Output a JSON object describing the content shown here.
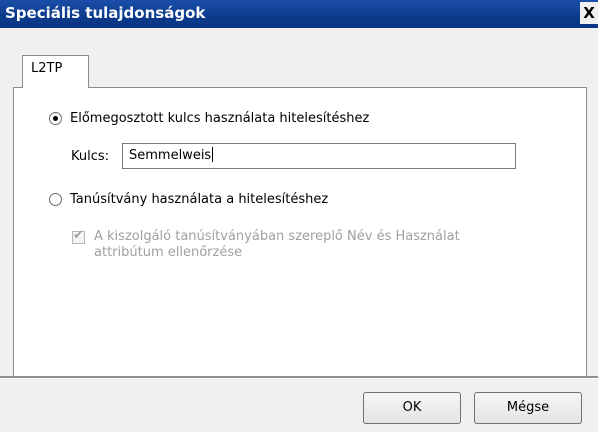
{
  "window": {
    "title": "Speciális tulajdonságok",
    "close_glyph": "X"
  },
  "tabs": [
    {
      "label": "L2TP",
      "selected": true
    }
  ],
  "options": {
    "preshared_key_label": "Előmegosztott kulcs használata hitelesítéshez",
    "preshared_key_selected": true,
    "key_field_label": "Kulcs:",
    "key_value": "Semmelweis",
    "certificate_label": "Tanúsítvány használata a hitelesítéshez",
    "certificate_selected": false,
    "verify_checkbox_label": "A kiszolgáló tanúsítványában szereplő Név és Használat attribútum ellenőrzése",
    "verify_checkbox_checked": true,
    "verify_checkbox_enabled": false
  },
  "buttons": {
    "ok_label": "OK",
    "cancel_label": "Mégse"
  },
  "colors": {
    "titlebar": "#0c3b8c",
    "disabled_text": "#a0a0a0"
  }
}
